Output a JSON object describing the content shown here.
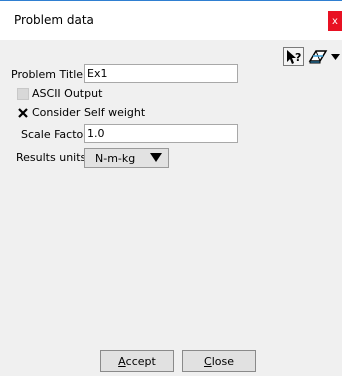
{
  "window": {
    "title": "Problem data",
    "close_glyph": "x",
    "close_color": "#e81123",
    "accent": "#2f7fd1"
  },
  "toolbar": {
    "help_icon": "whats-this-help-icon",
    "eraser_icon": "eraser-dropdown-icon"
  },
  "form": {
    "problem_title_label": "Problem Title",
    "problem_title_value": "Ex1",
    "ascii_output_label": "ASCII Output",
    "ascii_output_checked": false,
    "ascii_output_enabled": false,
    "self_weight_label": "Consider Self weight",
    "self_weight_checked": true,
    "scale_factor_label": "Scale Factor",
    "scale_factor_value": "1.0",
    "results_units_label": "Results units",
    "results_units_value": "N-m-kg"
  },
  "buttons": {
    "accept_mnemonic": "A",
    "accept_rest": "ccept",
    "close_mnemonic": "C",
    "close_rest": "lose"
  }
}
